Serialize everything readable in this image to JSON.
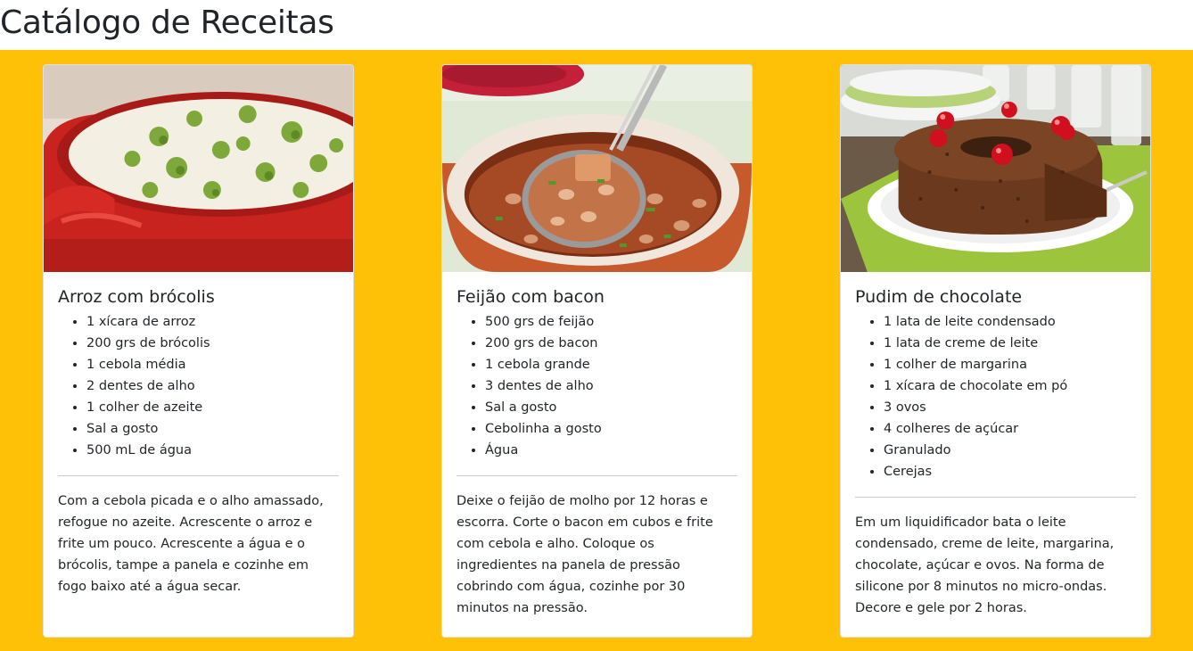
{
  "page": {
    "title": "Catálogo de Receitas"
  },
  "colors": {
    "background": "#ffc107",
    "card": "#ffffff",
    "text": "#212529"
  },
  "recipes": [
    {
      "title": "Arroz com brócolis",
      "image_alt": "rice-with-broccoli-in-red-pot",
      "ingredients": [
        "1 xícara de arroz",
        "200 grs de brócolis",
        "1 cebola média",
        "2 dentes de alho",
        "1 colher de azeite",
        "Sal a gosto",
        "500 mL de água"
      ],
      "instructions": "Com a cebola picada e o alho amassado, refogue no azeite. Acrescente o arroz e frite um pouco. Acrescente a água e o brócolis, tampe a panela e cozinhe em fogo baixo até a água secar."
    },
    {
      "title": "Feijão com bacon",
      "image_alt": "beans-with-bacon-in-clay-pot",
      "ingredients": [
        "500 grs de feijão",
        "200 grs de bacon",
        "1 cebola grande",
        "3 dentes de alho",
        "Sal a gosto",
        "Cebolinha a gosto",
        "Água"
      ],
      "instructions": "Deixe o feijão de molho por 12 horas e escorra. Corte o bacon em cubos e frite com cebola e alho. Coloque os ingredientes na panela de pressão cobrindo com água, cozinhe por 30 minutos na pressão."
    },
    {
      "title": "Pudim de chocolate",
      "image_alt": "chocolate-pudding-with-cherries",
      "ingredients": [
        "1 lata de leite condensado",
        "1 lata de creme de leite",
        "1 colher de margarina",
        "1 xícara de chocolate em pó",
        "3 ovos",
        "4 colheres de açúcar",
        "Granulado",
        "Cerejas"
      ],
      "instructions": "Em um liquidificador bata o leite condensado, creme de leite, margarina, chocolate, açúcar e ovos. Na forma de silicone por 8 minutos no micro-ondas. Decore e gele por 2 horas."
    }
  ]
}
